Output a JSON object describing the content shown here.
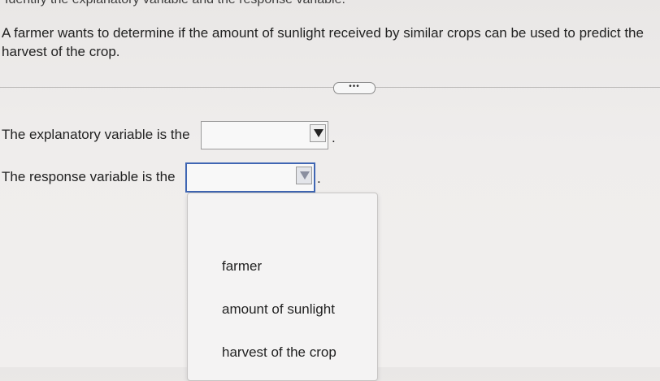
{
  "instruction": "Identify the explanatory variable and the response variable.",
  "question": "A farmer wants to determine if the amount of sunlight received by similar crops can be used to predict the harvest of the crop.",
  "more_button": "•••",
  "explanatory": {
    "label": "The explanatory variable is the",
    "value": "",
    "period": "."
  },
  "response": {
    "label": "The response variable is the",
    "value": "",
    "period": "."
  },
  "dropdown": {
    "options": [
      "farmer",
      "amount of sunlight",
      "harvest of the crop"
    ]
  }
}
